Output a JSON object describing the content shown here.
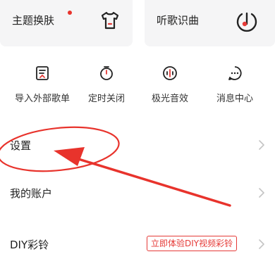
{
  "cards": {
    "skin_label": "主题换肤",
    "music_label": "听歌识曲"
  },
  "tools": [
    {
      "label": "导入外部歌单",
      "icon": "import-playlist-icon"
    },
    {
      "label": "定时关闭",
      "icon": "timer-icon"
    },
    {
      "label": "极光音效",
      "icon": "sound-effect-icon"
    },
    {
      "label": "消息中心",
      "icon": "message-center-icon"
    }
  ],
  "rows": {
    "settings": "设置",
    "account": "我的账户",
    "diy": "DIY彩铃",
    "diy_promo": "立即体验DIY视频彩铃"
  },
  "colors": {
    "accent": "#e53a37",
    "card_bg": "#f5f5f6"
  }
}
